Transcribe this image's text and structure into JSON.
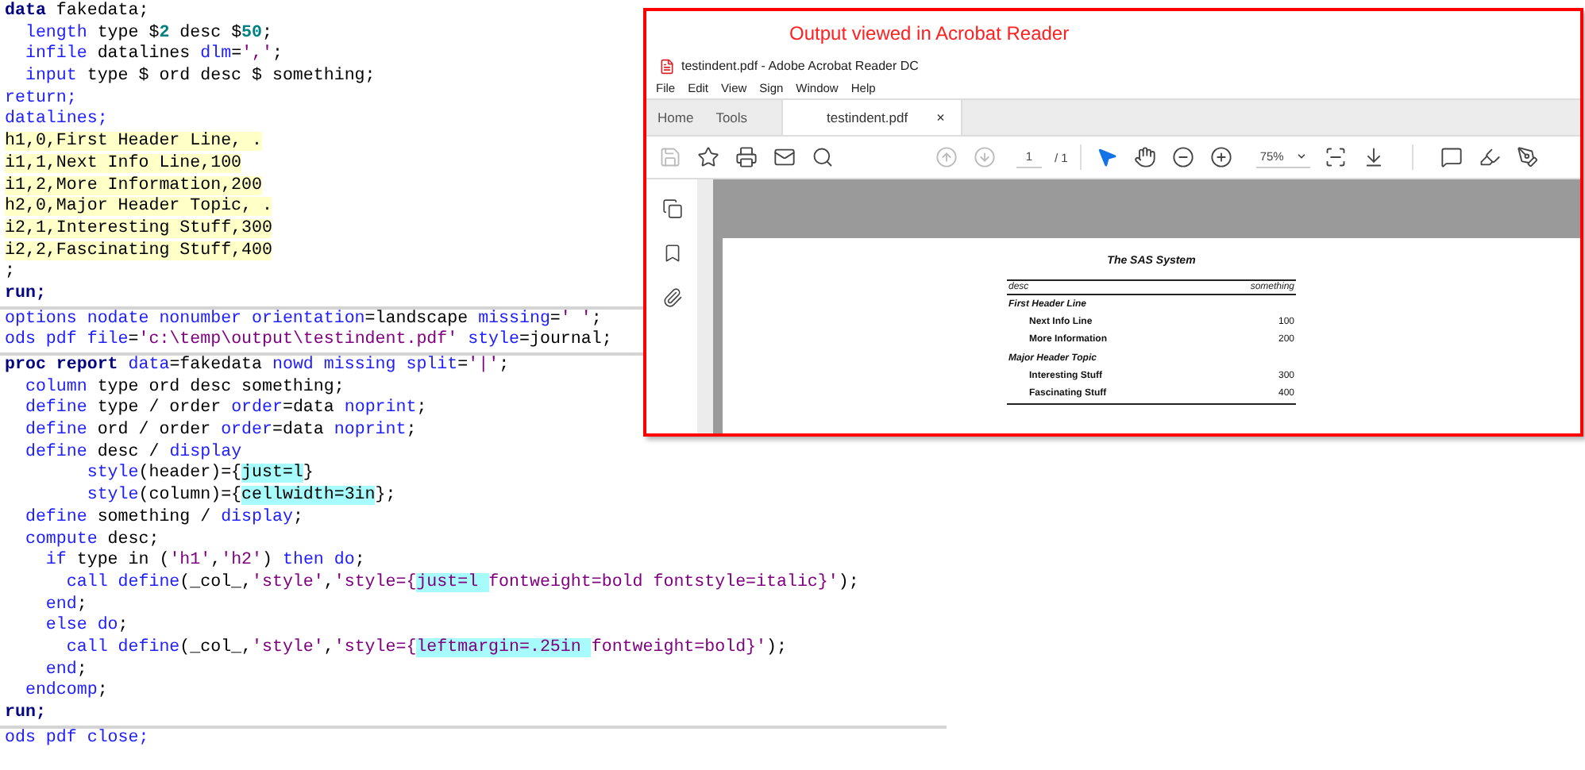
{
  "editor": {
    "lines": [
      {
        "tokens": [
          {
            "text": "data",
            "kind": "keyword"
          },
          {
            "text": " fakedata;",
            "kind": "plain"
          }
        ]
      },
      {
        "tokens": [
          {
            "text": "  length",
            "kind": "statement"
          },
          {
            "text": " type $",
            "kind": "plain"
          },
          {
            "text": "2",
            "kind": "number"
          },
          {
            "text": " desc $",
            "kind": "plain"
          },
          {
            "text": "50",
            "kind": "number"
          },
          {
            "text": ";",
            "kind": "plain"
          }
        ]
      },
      {
        "tokens": [
          {
            "text": "  infile",
            "kind": "statement"
          },
          {
            "text": " datalines ",
            "kind": "plain"
          },
          {
            "text": "dlm",
            "kind": "statement"
          },
          {
            "text": "=",
            "kind": "plain"
          },
          {
            "text": "','",
            "kind": "string"
          },
          {
            "text": ";",
            "kind": "plain"
          }
        ]
      },
      {
        "tokens": [
          {
            "text": "  input",
            "kind": "statement"
          },
          {
            "text": " type $ ord desc $ something;",
            "kind": "plain"
          }
        ]
      },
      {
        "tokens": [
          {
            "text": "return;",
            "kind": "statement"
          }
        ]
      },
      {
        "tokens": [
          {
            "text": "datalines;",
            "kind": "statement"
          }
        ]
      },
      {
        "tokens": [
          {
            "text": "h1,0,First Header Line, .",
            "kind": "data"
          }
        ]
      },
      {
        "tokens": [
          {
            "text": "i1,1,Next Info Line,100",
            "kind": "data"
          }
        ]
      },
      {
        "tokens": [
          {
            "text": "i1,2,More Information,200",
            "kind": "data"
          }
        ]
      },
      {
        "tokens": [
          {
            "text": "h2,0,Major Header Topic, .",
            "kind": "data"
          }
        ]
      },
      {
        "tokens": [
          {
            "text": "i2,1,Interesting Stuff,300",
            "kind": "data"
          }
        ]
      },
      {
        "tokens": [
          {
            "text": "i2,2,Fascinating Stuff,400",
            "kind": "data"
          }
        ]
      },
      {
        "tokens": [
          {
            "text": ";",
            "kind": "plain"
          }
        ]
      },
      {
        "tokens": [
          {
            "text": "run;",
            "kind": "keyword"
          }
        ],
        "rule_after": true
      },
      {
        "tokens": [
          {
            "text": "options nodate nonumber orientation",
            "kind": "statement"
          },
          {
            "text": "=landscape ",
            "kind": "plain"
          },
          {
            "text": "missing",
            "kind": "statement"
          },
          {
            "text": "=",
            "kind": "plain"
          },
          {
            "text": "' '",
            "kind": "string"
          },
          {
            "text": ";",
            "kind": "plain"
          }
        ]
      },
      {
        "tokens": [
          {
            "text": "ods pdf file",
            "kind": "statement"
          },
          {
            "text": "=",
            "kind": "plain"
          },
          {
            "text": "'c:\\temp\\output\\testindent.pdf'",
            "kind": "string"
          },
          {
            "text": " style",
            "kind": "statement"
          },
          {
            "text": "=journal;",
            "kind": "plain"
          }
        ],
        "rule_after": true
      },
      {
        "tokens": [
          {
            "text": "proc report",
            "kind": "keyword"
          },
          {
            "text": " data",
            "kind": "statement"
          },
          {
            "text": "=fakedata ",
            "kind": "plain"
          },
          {
            "text": "nowd missing split",
            "kind": "statement"
          },
          {
            "text": "=",
            "kind": "plain"
          },
          {
            "text": "'|'",
            "kind": "string"
          },
          {
            "text": ";",
            "kind": "plain"
          }
        ]
      },
      {
        "tokens": [
          {
            "text": "  column",
            "kind": "statement"
          },
          {
            "text": " type ord desc something;",
            "kind": "plain"
          }
        ]
      },
      {
        "tokens": [
          {
            "text": "  define",
            "kind": "statement"
          },
          {
            "text": " type / order ",
            "kind": "plain"
          },
          {
            "text": "order",
            "kind": "statement"
          },
          {
            "text": "=data ",
            "kind": "plain"
          },
          {
            "text": "noprint",
            "kind": "statement"
          },
          {
            "text": ";",
            "kind": "plain"
          }
        ]
      },
      {
        "tokens": [
          {
            "text": "  define",
            "kind": "statement"
          },
          {
            "text": " ord / order ",
            "kind": "plain"
          },
          {
            "text": "order",
            "kind": "statement"
          },
          {
            "text": "=data ",
            "kind": "plain"
          },
          {
            "text": "noprint",
            "kind": "statement"
          },
          {
            "text": ";",
            "kind": "plain"
          }
        ]
      },
      {
        "tokens": [
          {
            "text": "  define",
            "kind": "statement"
          },
          {
            "text": " desc / ",
            "kind": "plain"
          },
          {
            "text": "display",
            "kind": "statement"
          }
        ]
      },
      {
        "tokens": [
          {
            "text": "        style",
            "kind": "statement"
          },
          {
            "text": "(header)={",
            "kind": "plain"
          },
          {
            "text": "just=l",
            "kind": "plain",
            "highlighted": true
          },
          {
            "text": "}",
            "kind": "plain"
          }
        ]
      },
      {
        "tokens": [
          {
            "text": "        style",
            "kind": "statement"
          },
          {
            "text": "(column)={",
            "kind": "plain"
          },
          {
            "text": "cellwidth=3in",
            "kind": "plain",
            "highlighted": true
          },
          {
            "text": "};",
            "kind": "plain"
          }
        ]
      },
      {
        "tokens": [
          {
            "text": "  define",
            "kind": "statement"
          },
          {
            "text": " something / ",
            "kind": "plain"
          },
          {
            "text": "display",
            "kind": "statement"
          },
          {
            "text": ";",
            "kind": "plain"
          }
        ]
      },
      {
        "tokens": [
          {
            "text": "  compute",
            "kind": "statement"
          },
          {
            "text": " desc;",
            "kind": "plain"
          }
        ]
      },
      {
        "tokens": [
          {
            "text": "    if",
            "kind": "statement"
          },
          {
            "text": " type in (",
            "kind": "plain"
          },
          {
            "text": "'h1'",
            "kind": "string"
          },
          {
            "text": ",",
            "kind": "plain"
          },
          {
            "text": "'h2'",
            "kind": "string"
          },
          {
            "text": ") ",
            "kind": "plain"
          },
          {
            "text": "then do",
            "kind": "statement"
          },
          {
            "text": ";",
            "kind": "plain"
          }
        ]
      },
      {
        "tokens": [
          {
            "text": "      call define",
            "kind": "statement"
          },
          {
            "text": "(_col_,",
            "kind": "plain"
          },
          {
            "text": "'style'",
            "kind": "string"
          },
          {
            "text": ",",
            "kind": "plain"
          },
          {
            "text": "'style={",
            "kind": "string"
          },
          {
            "text": "just=l ",
            "kind": "string",
            "highlighted": true
          },
          {
            "text": "fontweight=bold fontstyle=italic}'",
            "kind": "string"
          },
          {
            "text": ");",
            "kind": "plain"
          }
        ]
      },
      {
        "tokens": [
          {
            "text": "    end",
            "kind": "statement"
          },
          {
            "text": ";",
            "kind": "plain"
          }
        ]
      },
      {
        "tokens": [
          {
            "text": "    else do",
            "kind": "statement"
          },
          {
            "text": ";",
            "kind": "plain"
          }
        ]
      },
      {
        "tokens": [
          {
            "text": "      call define",
            "kind": "statement"
          },
          {
            "text": "(_col_,",
            "kind": "plain"
          },
          {
            "text": "'style'",
            "kind": "string"
          },
          {
            "text": ",",
            "kind": "plain"
          },
          {
            "text": "'style={",
            "kind": "string"
          },
          {
            "text": "leftmargin=.25in ",
            "kind": "string",
            "highlighted": true
          },
          {
            "text": "fontweight=bold}'",
            "kind": "string"
          },
          {
            "text": ");",
            "kind": "plain"
          }
        ]
      },
      {
        "tokens": [
          {
            "text": "    end",
            "kind": "statement"
          },
          {
            "text": ";",
            "kind": "plain"
          }
        ]
      },
      {
        "tokens": [
          {
            "text": "  endcomp",
            "kind": "statement"
          },
          {
            "text": ";",
            "kind": "plain"
          }
        ]
      },
      {
        "tokens": [
          {
            "text": "run;",
            "kind": "keyword"
          }
        ],
        "rule_after": true
      },
      {
        "tokens": [
          {
            "text": "ods pdf close;",
            "kind": "statement"
          }
        ]
      }
    ]
  },
  "callout": {
    "caption": "Output viewed in Acrobat Reader"
  },
  "reader": {
    "title": "testindent.pdf - Adobe Acrobat Reader DC",
    "menu": [
      "File",
      "Edit",
      "View",
      "Sign",
      "Window",
      "Help"
    ],
    "tabs": [
      {
        "label": "Home",
        "selected": false
      },
      {
        "label": "Tools",
        "selected": false
      },
      {
        "label": "testindent.pdf",
        "selected": true,
        "close": "×"
      }
    ],
    "toolbar": {
      "file_tools": [
        {
          "disabled": true
        },
        {
          "disabled": false
        },
        {
          "disabled": false
        },
        {
          "disabled": false
        },
        {
          "disabled": false
        }
      ],
      "nav_tools": [
        {
          "disabled": true
        },
        {
          "disabled": true
        }
      ],
      "page": {
        "value": "1",
        "total": "/ 1"
      },
      "view_tools": [
        {
          "selected": true
        },
        {
          "selected": false
        },
        {
          "selected": false
        },
        {
          "selected": false
        }
      ],
      "zoom": "75%",
      "extra_tools": [
        {
          "disabled": false
        },
        {
          "disabled": false
        },
        {
          "disabled": false
        },
        {
          "disabled": false
        },
        {
          "disabled": false
        }
      ]
    },
    "side_panel": [
      {
        "disabled": false
      },
      {
        "disabled": false
      },
      {
        "disabled": false
      }
    ],
    "report": {
      "title": "The SAS System",
      "columns": [
        "desc",
        "something"
      ],
      "rows": [
        {
          "kind": "group",
          "desc": "First Header Line"
        },
        {
          "kind": "item",
          "desc": "Next Info Line",
          "something": "100"
        },
        {
          "kind": "item",
          "desc": "More Information",
          "something": "200"
        },
        {
          "kind": "group",
          "desc": "Major Header Topic"
        },
        {
          "kind": "item",
          "desc": "Interesting Stuff",
          "something": "300"
        },
        {
          "kind": "item",
          "desc": "Fascinating Stuff",
          "something": "400"
        }
      ]
    }
  }
}
